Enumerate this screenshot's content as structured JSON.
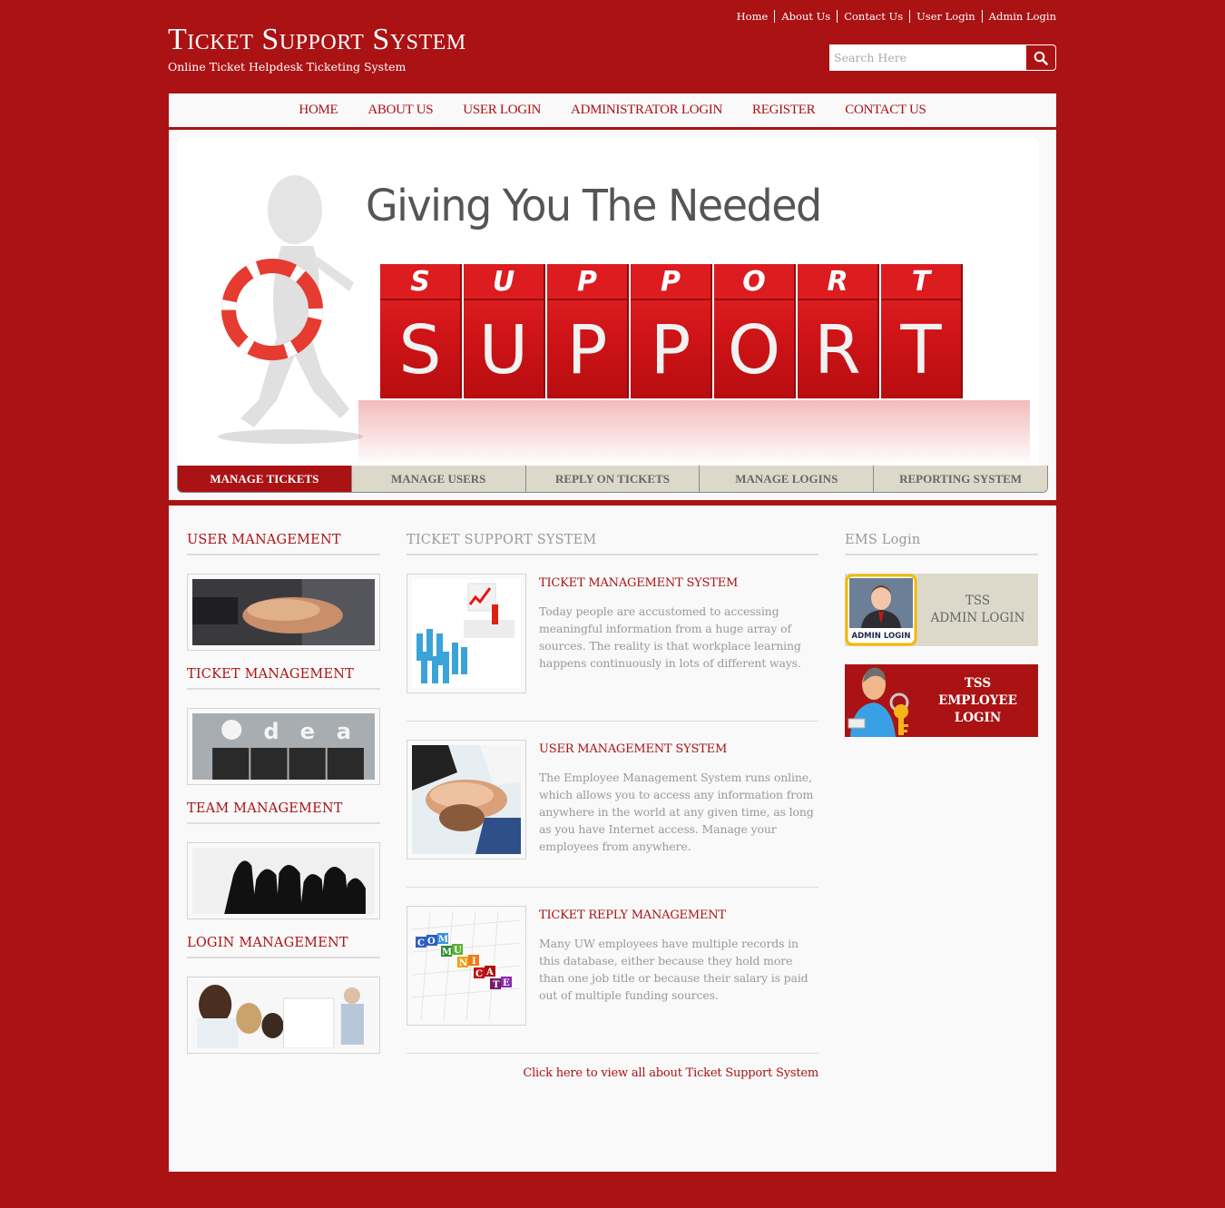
{
  "header": {
    "site_title": "Ticket Support System",
    "tagline": "Online Ticket Helpdesk Ticketing System",
    "top_links": [
      "Home",
      "About Us",
      "Contact Us",
      "User Login",
      "Admin Login"
    ],
    "search": {
      "placeholder": "Search Here",
      "value": "",
      "icon": "search-icon"
    }
  },
  "main_nav": [
    "HOME",
    "ABOUT US",
    "USER LOGIN",
    "ADMINISTRATOR LOGIN",
    "REGISTER",
    "CONTACT US"
  ],
  "banner": {
    "tagline": "Giving You The Needed",
    "word": [
      "S",
      "U",
      "P",
      "P",
      "O",
      "R",
      "T"
    ]
  },
  "feature_tabs": {
    "active": 0,
    "items": [
      "MANAGE TICKETS",
      "MANAGE USERS",
      "REPLY ON TICKETS",
      "MANAGE LOGINS",
      "REPORTING SYSTEM"
    ]
  },
  "left_sidebar": [
    {
      "heading": "USER MANAGEMENT",
      "image": "hands-stacked-business-image"
    },
    {
      "heading": "TICKET MANAGEMENT",
      "image": "idea-lightbulb-team-image"
    },
    {
      "heading": "TEAM MANAGEMENT",
      "image": "team-silhouette-image"
    },
    {
      "heading": "LOGIN MANAGEMENT",
      "image": "presentation-meeting-image"
    }
  ],
  "center": {
    "heading": "TICKET SUPPORT SYSTEM",
    "articles": [
      {
        "title": "TICKET MANAGEMENT SYSTEM",
        "text": "Today people are accustomed to accessing meaningful information from a huge array of sources. The reality is that workplace learning happens continuously in lots of different ways.",
        "image": "presenter-crowd-image"
      },
      {
        "title": "USER MANAGEMENT SYSTEM",
        "text": "The Employee Management System runs online, which allows you to access any information from anywhere in the world at any given time, as long as you have Internet access. Manage your employees from anywhere.",
        "image": "hands-teamwork-image"
      },
      {
        "title": "TICKET REPLY MANAGEMENT",
        "text": "Many UW employees have multiple records in this database, either because they hold more than one job title or because their salary is paid out of multiple funding sources.",
        "image": "communicate-blocks-image"
      }
    ],
    "view_all_link": "Click here to view all about Ticket Support System"
  },
  "right_sidebar": {
    "heading": "EMS Login",
    "admin_card": {
      "line1": "TSS",
      "line2": "ADMIN LOGIN",
      "badge": "ADMIN LOGIN"
    },
    "employee_card": {
      "line1": "TSS",
      "line2": "EMPLOYEE",
      "line3": "LOGIN"
    }
  },
  "colors": {
    "brand_red": "#ab1214",
    "tab_beige": "#dcd9cb",
    "body_grey": "#999999"
  }
}
